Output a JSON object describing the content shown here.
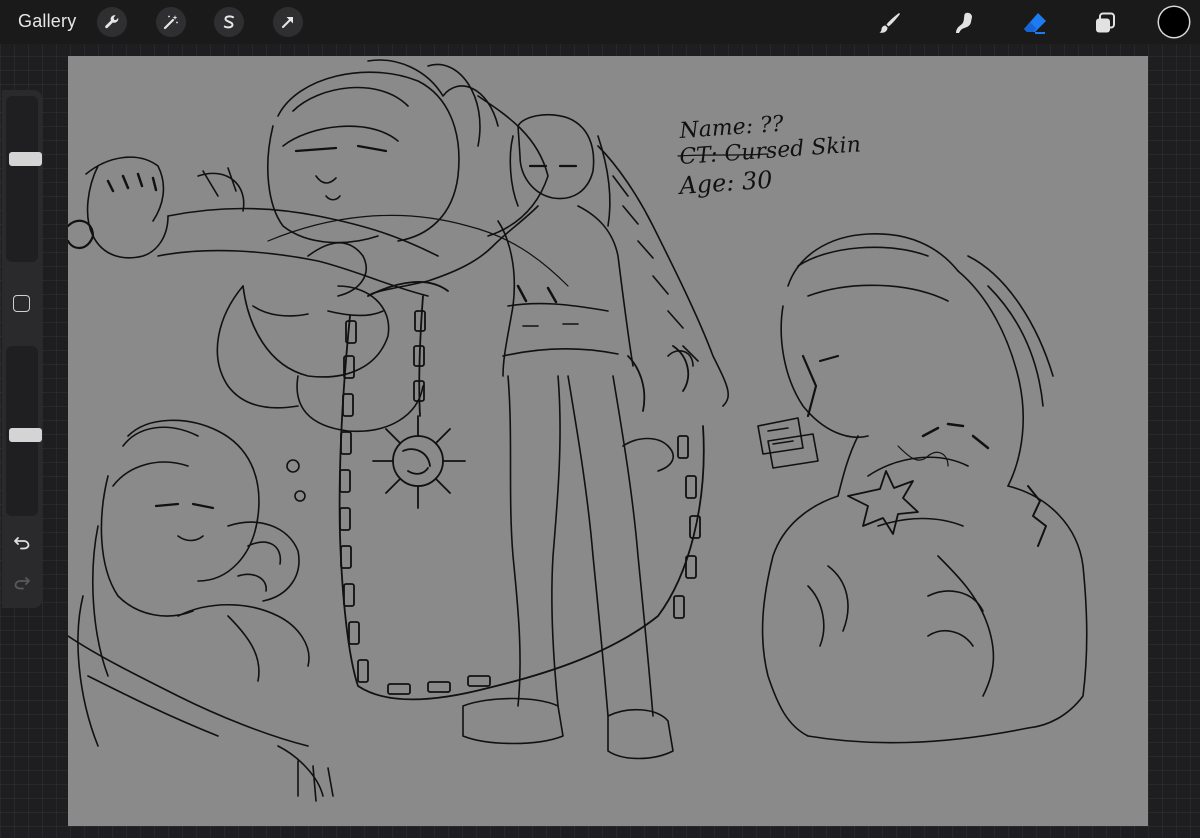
{
  "toolbar": {
    "gallery_label": "Gallery",
    "left_tools": [
      {
        "name": "actions",
        "icon": "wrench-icon"
      },
      {
        "name": "adjustments",
        "icon": "magic-wand-icon"
      },
      {
        "name": "selection",
        "icon": "selection-s-icon"
      },
      {
        "name": "transform",
        "icon": "arrow-cursor-icon"
      }
    ],
    "right_tools": [
      {
        "name": "brush",
        "icon": "brush-icon",
        "active": false
      },
      {
        "name": "smudge",
        "icon": "smudge-icon",
        "active": false
      },
      {
        "name": "eraser",
        "icon": "eraser-icon",
        "active": true
      },
      {
        "name": "layers",
        "icon": "layers-icon",
        "active": false
      }
    ],
    "current_color": "#000000",
    "active_tool_color": "#1e7cf2"
  },
  "sidebar": {
    "brush_size_level": 0.8,
    "opacity_level": 0.5,
    "icons": [
      "square-modify-icon",
      "undo-icon",
      "redo-icon"
    ]
  },
  "canvas": {
    "background": "#8a8a8a",
    "notes": {
      "line1": "Name: ??",
      "line2": "CT: Cursed Skin",
      "line3": "Age: 30"
    }
  }
}
